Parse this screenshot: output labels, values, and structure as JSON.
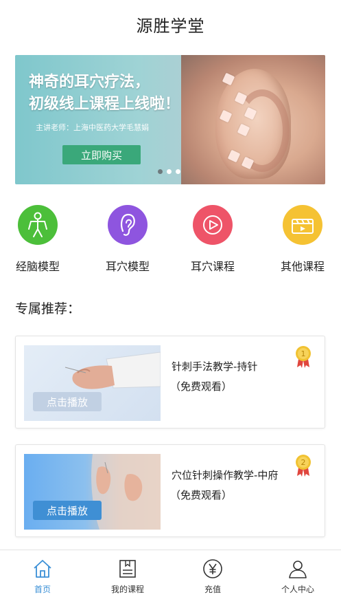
{
  "header": {
    "title": "源胜学堂"
  },
  "banner": {
    "headline": "神奇的耳穴疗法，\n初级线上课程上线啦！",
    "teacher": "主讲老师：上海中医药大学毛慧娟",
    "buy_label": "立即购买",
    "slide_count": 3,
    "active_slide": 1
  },
  "categories": [
    {
      "label": "经脑模型",
      "icon": "person-icon",
      "color": "#4cbf3a"
    },
    {
      "label": "耳穴模型",
      "icon": "ear-icon",
      "color": "#8e55df"
    },
    {
      "label": "耳穴课程",
      "icon": "play-icon",
      "color": "#ee5468"
    },
    {
      "label": "其他课程",
      "icon": "clapperboard-icon",
      "color": "#f5c233"
    }
  ],
  "section": {
    "title": "专属推荐："
  },
  "courses": [
    {
      "title": "针刺手法教学-持针",
      "subtitle": "（免费观看）",
      "play_label": "点击播放",
      "rank": "1"
    },
    {
      "title": "穴位针刺操作教学-中府",
      "subtitle": "（免费观看）",
      "play_label": "点击播放",
      "rank": "2"
    }
  ],
  "tabbar": {
    "items": [
      {
        "label": "首页",
        "icon": "home-icon"
      },
      {
        "label": "我的课程",
        "icon": "book-icon"
      },
      {
        "label": "充值",
        "icon": "yen-icon"
      },
      {
        "label": "个人中心",
        "icon": "user-icon"
      }
    ],
    "active_color": "#3a8fd6"
  }
}
